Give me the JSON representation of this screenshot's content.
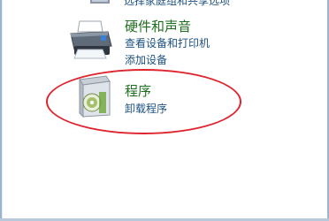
{
  "top_cut": {
    "text": "选择家庭组和共享选项"
  },
  "categories": [
    {
      "title": "硬件和声音",
      "icon": "printer-icon",
      "links": [
        "查看设备和打印机",
        "添加设备"
      ]
    },
    {
      "title": "程序",
      "icon": "programs-icon",
      "links": [
        "卸载程序"
      ]
    }
  ],
  "colors": {
    "category_title": "#1e6e1e",
    "link": "#1c5180",
    "annotation": "#e0242e"
  }
}
